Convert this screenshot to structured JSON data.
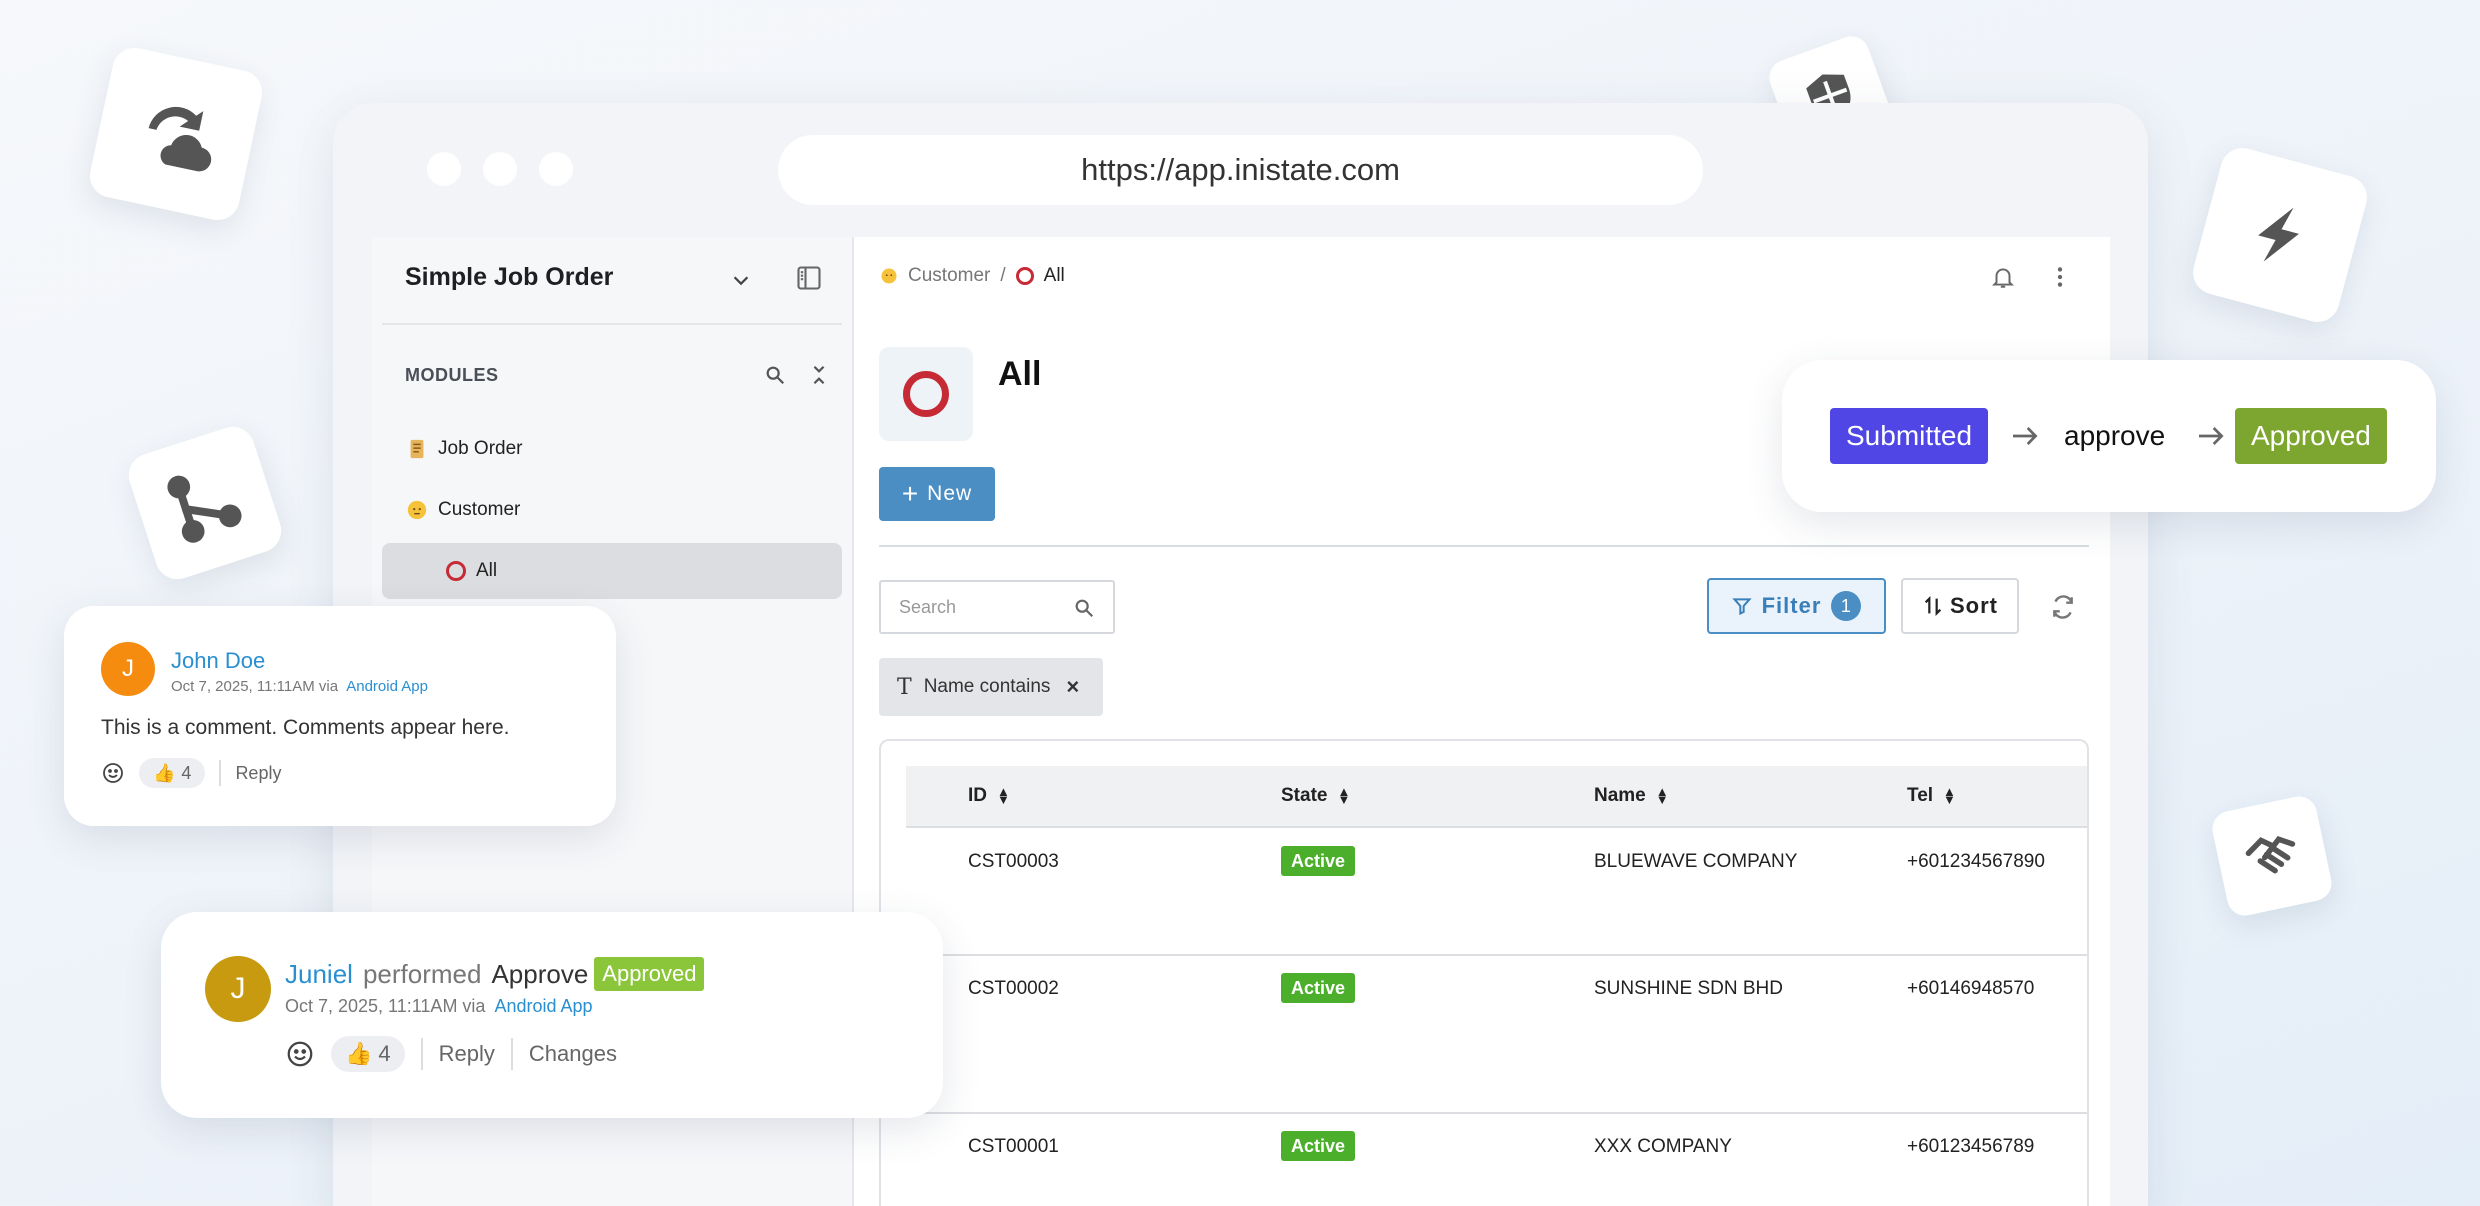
{
  "browser": {
    "url": "https://app.inistate.com"
  },
  "sidebar": {
    "app_title": "Simple Job Order",
    "section_label": "MODULES",
    "items": [
      {
        "label": "Job Order",
        "icon": "scroll-icon"
      },
      {
        "label": "Customer",
        "icon": "face-icon"
      },
      {
        "label": "All",
        "icon": "ring-icon"
      }
    ]
  },
  "breadcrumb": {
    "parent": "Customer",
    "separator": "/",
    "current": "All"
  },
  "page": {
    "title": "All"
  },
  "toolbar": {
    "new_label": "New",
    "search_placeholder": "Search",
    "filter_label": "Filter",
    "filter_count": "1",
    "sort_label": "Sort"
  },
  "filter_chip": {
    "icon_glyph": "T",
    "label": "Name contains"
  },
  "table": {
    "columns": [
      "ID",
      "State",
      "Name",
      "Tel"
    ],
    "rows": [
      {
        "id": "CST00003",
        "state": "Active",
        "name": "BLUEWAVE COMPANY",
        "tel": "+601234567890"
      },
      {
        "id": "CST00002",
        "state": "Active",
        "name": "SUNSHINE SDN BHD",
        "tel": "+60146948570"
      },
      {
        "id": "CST00001",
        "state": "Active",
        "name": "XXX COMPANY",
        "tel": "+60123456789"
      }
    ]
  },
  "workflow": {
    "from": "Submitted",
    "action": "approve",
    "to": "Approved"
  },
  "comment": {
    "avatar_initial": "J",
    "author": "John Doe",
    "date": "Oct 7, 2025, 11:11AM via",
    "source": "Android App",
    "text": "This is a comment. Comments appear here.",
    "reaction_emoji": "👍",
    "reaction_count": "4",
    "reply_label": "Reply"
  },
  "activity": {
    "avatar_initial": "J",
    "author": "Juniel",
    "verb": "performed",
    "action": "Approve",
    "status": "Approved",
    "date": "Oct 7, 2025, 11:11AM via",
    "source": "Android App",
    "reaction_emoji": "👍",
    "reaction_count": "4",
    "reply_label": "Reply",
    "changes_label": "Changes"
  },
  "colors": {
    "accent": "#4a8ec4",
    "active_green": "#4caf2b",
    "submitted": "#4f46e5",
    "approved": "#7ca630",
    "link": "#2a8fd1",
    "brand_red": "#c62b35"
  }
}
